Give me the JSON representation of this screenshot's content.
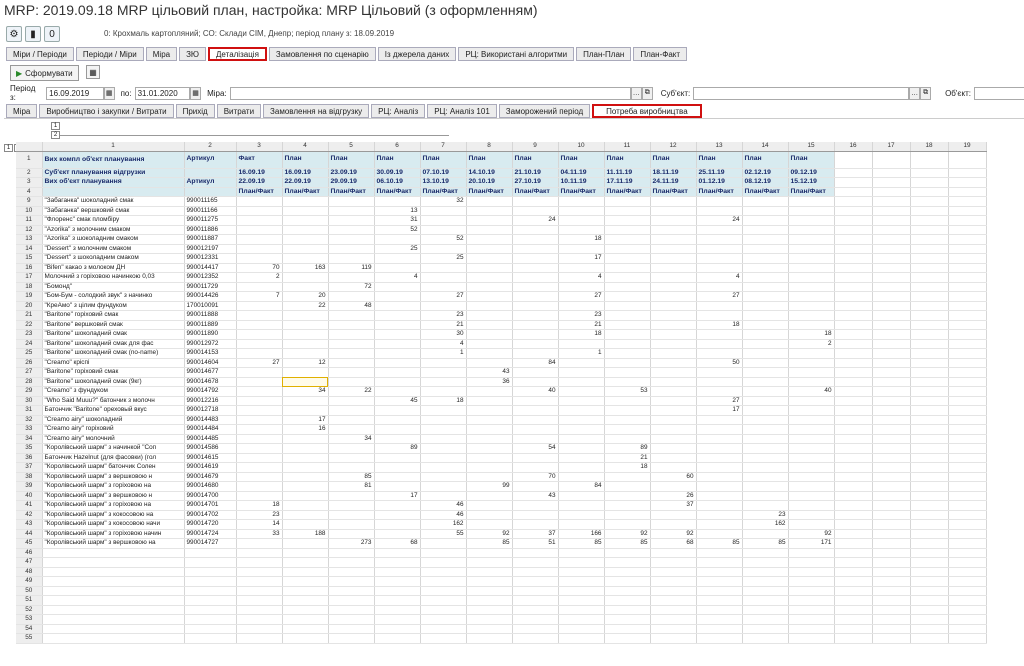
{
  "window": {
    "title": "MRP: 2019.09.18 MRP цільовий план, настройка: MRP Цільовий (з оформленням)"
  },
  "toolbar": {
    "counter": "0",
    "info": "0: Крохмаль картопляний; СО: Склади СІМ, Днепр; період плану з: 18.09.2019"
  },
  "tabs_top": [
    "Міри / Періоди",
    "Періоди / Міри",
    "Міра",
    "ЗЮ",
    "Деталізація",
    "Замовлення по сценарію",
    "Із джерела даних",
    "РЦ: Використані алгоритми",
    "План-План",
    "План-Факт"
  ],
  "buttons": {
    "generate": "Сформувати"
  },
  "filters": {
    "period_from_label": "Період з:",
    "period_from": "16.09.2019",
    "period_to_label": "по:",
    "period_to": "31.01.2020",
    "mira_label": "Міра:",
    "mira_value": "",
    "subject_label": "Суб'єкт:",
    "subject_value": "",
    "object_label": "Об'єкт:",
    "object_value": ""
  },
  "tabs_second": [
    "Міра",
    "Виробництво і закупки / Витрати",
    "Прихід",
    "Витрати",
    "Замовлення на відгрузку",
    "РЦ: Аналіз",
    "РЦ: Аналіз 101",
    "Заморожений період",
    "Потреба виробництва"
  ],
  "grid": {
    "outline_levels": [
      "1",
      "2",
      "3"
    ],
    "outline_markers": [
      "1",
      "2"
    ],
    "col_headers": [
      "1",
      "2",
      "3",
      "4",
      "5",
      "6",
      "7",
      "8",
      "9",
      "10",
      "11",
      "12",
      "13",
      "14",
      "15",
      "16",
      "17",
      "18",
      "19"
    ],
    "h1": {
      "a": "Вих компл об'єкт планування",
      "b": "Артикул",
      "vals": [
        "Факт",
        "План",
        "План",
        "План",
        "План",
        "План",
        "План",
        "План",
        "План",
        "План",
        "План",
        "План",
        "План"
      ]
    },
    "h2": {
      "a": "Суб'єкт планування відгрузки",
      "b": "",
      "vals": [
        "16.09.19",
        "16.09.19",
        "23.09.19",
        "30.09.19",
        "07.10.19",
        "14.10.19",
        "21.10.19",
        "04.11.19",
        "11.11.19",
        "18.11.19",
        "25.11.19",
        "02.12.19",
        "09.12.19"
      ]
    },
    "h3": {
      "a": "Вих об'єкт планування",
      "b": "Артикул",
      "vals": [
        "22.09.19",
        "22.09.19",
        "29.09.19",
        "06.10.19",
        "13.10.19",
        "20.10.19",
        "27.10.19",
        "10.11.19",
        "17.11.19",
        "24.11.19",
        "01.12.19",
        "08.12.19",
        "15.12.19"
      ]
    },
    "h4": {
      "a": "",
      "b": "",
      "vals": [
        "План/Факт",
        "План/Факт",
        "План/Факт",
        "План/Факт",
        "План/Факт",
        "План/Факт",
        "План/Факт",
        "План/Факт",
        "План/Факт",
        "План/Факт",
        "План/Факт",
        "План/Факт",
        "План/Факт"
      ]
    },
    "rows": [
      {
        "n": "9",
        "name": "\"Забаганка\" шоколадний смак",
        "art": "990011165",
        "v": [
          "",
          "",
          "",
          "",
          "32",
          "",
          "",
          "",
          "",
          "",
          "",
          "",
          ""
        ]
      },
      {
        "n": "10",
        "name": "\"Забаганка\" вершковий смак",
        "art": "990011166",
        "v": [
          "",
          "",
          "",
          "13",
          "",
          "",
          "",
          "",
          "",
          "",
          "",
          "",
          ""
        ]
      },
      {
        "n": "11",
        "name": "\"Флоренс\" смак пломбіру",
        "art": "990011275",
        "v": [
          "",
          "",
          "",
          "31",
          "",
          "",
          "24",
          "",
          "",
          "",
          "24",
          "",
          ""
        ]
      },
      {
        "n": "12",
        "name": "\"Azorika\" з молочним смаком",
        "art": "990011886",
        "v": [
          "",
          "",
          "",
          "52",
          "",
          "",
          "",
          "",
          "",
          "",
          "",
          "",
          ""
        ]
      },
      {
        "n": "13",
        "name": "\"Azorika\" з шоколадним смаком",
        "art": "990011887",
        "v": [
          "",
          "",
          "",
          "",
          "52",
          "",
          "",
          "18",
          "",
          "",
          "",
          "",
          ""
        ]
      },
      {
        "n": "14",
        "name": "\"Dessert\" з молочним смаком",
        "art": "990012197",
        "v": [
          "",
          "",
          "",
          "25",
          "",
          "",
          "",
          "",
          "",
          "",
          "",
          "",
          ""
        ]
      },
      {
        "n": "15",
        "name": "\"Dessert\" з шоколадним смаком",
        "art": "990012331",
        "v": [
          "",
          "",
          "",
          "",
          "25",
          "",
          "",
          "17",
          "",
          "",
          "",
          "",
          ""
        ]
      },
      {
        "n": "16",
        "name": "\"Bifen\" какао з молоком ДН",
        "art": "990014417",
        "v": [
          "70",
          "163",
          "119",
          "",
          "",
          "",
          "",
          "",
          "",
          "",
          "",
          "",
          ""
        ]
      },
      {
        "n": "17",
        "name": "Молочний з горіховою начинкою 0,03",
        "art": "990012352",
        "v": [
          "2",
          "",
          "",
          "4",
          "",
          "",
          "",
          "4",
          "",
          "",
          "4",
          "",
          ""
        ]
      },
      {
        "n": "18",
        "name": "\"Бомонд\"",
        "art": "990011729",
        "v": [
          "",
          "",
          "72",
          "",
          "",
          "",
          "",
          "",
          "",
          "",
          "",
          "",
          ""
        ]
      },
      {
        "n": "19",
        "name": "\"Бом-Бум - солодкий звук\" з начинко",
        "art": "990014426",
        "v": [
          "7",
          "20",
          "",
          "",
          "27",
          "",
          "",
          "27",
          "",
          "",
          "27",
          "",
          ""
        ]
      },
      {
        "n": "20",
        "name": "\"КреАмо\" з цілим фундуком",
        "art": "170010091",
        "v": [
          "",
          "22",
          "48",
          "",
          "",
          "",
          "",
          "",
          "",
          "",
          "",
          "",
          ""
        ]
      },
      {
        "n": "21",
        "name": "\"Baritone\" горіховий смак",
        "art": "990011888",
        "v": [
          "",
          "",
          "",
          "",
          "23",
          "",
          "",
          "23",
          "",
          "",
          "",
          "",
          ""
        ]
      },
      {
        "n": "22",
        "name": "\"Baritone\" вершковий смак",
        "art": "990011889",
        "v": [
          "",
          "",
          "",
          "",
          "21",
          "",
          "",
          "21",
          "",
          "",
          "18",
          "",
          ""
        ]
      },
      {
        "n": "23",
        "name": "\"Baritone\" шоколадний смак",
        "art": "990011890",
        "v": [
          "",
          "",
          "",
          "",
          "30",
          "",
          "",
          "18",
          "",
          "",
          "",
          "",
          "18"
        ]
      },
      {
        "n": "24",
        "name": "\"Baritone\" шоколадний смак для фас",
        "art": "990012972",
        "v": [
          "",
          "",
          "",
          "",
          "4",
          "",
          "",
          "",
          "",
          "",
          "",
          "",
          "2"
        ]
      },
      {
        "n": "25",
        "name": "\"Baritone\" шоколадний смак (no-name)",
        "art": "990014153",
        "v": [
          "",
          "",
          "",
          "",
          "1",
          "",
          "",
          "1",
          "",
          "",
          "",
          "",
          ""
        ]
      },
      {
        "n": "26",
        "name": "\"Creamo\" кріспі",
        "art": "990014604",
        "v": [
          "27",
          "12",
          "",
          "",
          "",
          "",
          "84",
          "",
          "",
          "",
          "50",
          "",
          ""
        ]
      },
      {
        "n": "27",
        "name": "\"Baritone\" горіховий смак",
        "art": "990014677",
        "v": [
          "",
          "",
          "",
          "",
          "",
          "43",
          "",
          "",
          "",
          "",
          "",
          "",
          ""
        ]
      },
      {
        "n": "28",
        "name": "\"Baritone\" шоколадний смак (9кг)",
        "art": "990014678",
        "v": [
          "",
          "",
          "",
          "",
          "",
          "36",
          "",
          "",
          "",
          "",
          "",
          "",
          ""
        ]
      },
      {
        "n": "29",
        "name": "\"Creamo\" з фундуком",
        "art": "990014792",
        "v": [
          "",
          "34",
          "22",
          "",
          "",
          "",
          "40",
          "",
          "53",
          "",
          "",
          "",
          "40"
        ]
      },
      {
        "n": "30",
        "name": "\"Who Said Muuu?\" батончик з молочн",
        "art": "990012216",
        "v": [
          "",
          "",
          "",
          "45",
          "18",
          "",
          "",
          "",
          "",
          "",
          "27",
          "",
          ""
        ]
      },
      {
        "n": "31",
        "name": "Батончик \"Baritone\" ореховый вкус",
        "art": "990012718",
        "v": [
          "",
          "",
          "",
          "",
          "",
          "",
          "",
          "",
          "",
          "",
          "17",
          "",
          ""
        ]
      },
      {
        "n": "32",
        "name": "\"Creamo airy\" шоколадний",
        "art": "990014483",
        "v": [
          "",
          "17",
          "",
          "",
          "",
          "",
          "",
          "",
          "",
          "",
          "",
          "",
          ""
        ]
      },
      {
        "n": "33",
        "name": "\"Creamo airy\" горіховий",
        "art": "990014484",
        "v": [
          "",
          "16",
          "",
          "",
          "",
          "",
          "",
          "",
          "",
          "",
          "",
          "",
          ""
        ]
      },
      {
        "n": "34",
        "name": "\"Creamo airy\" молочний",
        "art": "990014485",
        "v": [
          "",
          "",
          "34",
          "",
          "",
          "",
          "",
          "",
          "",
          "",
          "",
          "",
          ""
        ]
      },
      {
        "n": "35",
        "name": "\"Королівський шарм\" з начинкой \"Соп",
        "art": "990014586",
        "v": [
          "",
          "",
          "",
          "89",
          "",
          "",
          "54",
          "",
          "89",
          "",
          "",
          "",
          ""
        ]
      },
      {
        "n": "36",
        "name": "Батончик Hazelnut (для фасовки) (гол",
        "art": "990014615",
        "v": [
          "",
          "",
          "",
          "",
          "",
          "",
          "",
          "",
          "21",
          "",
          "",
          "",
          ""
        ]
      },
      {
        "n": "37",
        "name": "\"Королівський шарм\" батончик Солен",
        "art": "990014619",
        "v": [
          "",
          "",
          "",
          "",
          "",
          "",
          "",
          "",
          "18",
          "",
          "",
          "",
          ""
        ]
      },
      {
        "n": "38",
        "name": "\"Королівський шарм\" з вершковою н",
        "art": "990014679",
        "v": [
          "",
          "",
          "85",
          "",
          "",
          "",
          "70",
          "",
          "",
          "60",
          "",
          "",
          ""
        ]
      },
      {
        "n": "39",
        "name": "\"Королівський шарм\" з горіховою на",
        "art": "990014680",
        "v": [
          "",
          "",
          "81",
          "",
          "",
          "99",
          "",
          "84",
          "",
          "",
          "",
          "",
          ""
        ]
      },
      {
        "n": "40",
        "name": "\"Королівський шарм\" з вершковою н",
        "art": "990014700",
        "v": [
          "",
          "",
          "",
          "17",
          "",
          "",
          "43",
          "",
          "",
          "26",
          "",
          "",
          ""
        ]
      },
      {
        "n": "41",
        "name": "\"Королівський шарм\" з горіховою на",
        "art": "990014701",
        "v": [
          "18",
          "",
          "",
          "",
          "46",
          "",
          "",
          "",
          "",
          "37",
          "",
          "",
          ""
        ]
      },
      {
        "n": "42",
        "name": "\"Королівський шарм\" з кокосовою на",
        "art": "990014702",
        "v": [
          "23",
          "",
          "",
          "",
          "46",
          "",
          "",
          "",
          "",
          "",
          "",
          "23",
          ""
        ]
      },
      {
        "n": "43",
        "name": "\"Королівський шарм\" з кокосовою начи",
        "art": "990014720",
        "v": [
          "14",
          "",
          "",
          "",
          "162",
          "",
          "",
          "",
          "",
          "",
          "",
          "162",
          ""
        ]
      },
      {
        "n": "44",
        "name": "\"Королівський шарм\" з горіховою начин",
        "art": "990014724",
        "v": [
          "33",
          "188",
          "",
          "",
          "55",
          "92",
          "37",
          "166",
          "92",
          "92",
          "",
          "",
          "92"
        ]
      },
      {
        "n": "45",
        "name": "\"Королівський шарм\" з вершковою на",
        "art": "990014727",
        "v": [
          "",
          "",
          "273",
          "68",
          "",
          "85",
          "51",
          "85",
          "85",
          "68",
          "85",
          "85",
          "171"
        ]
      }
    ],
    "empty_rows": [
      "46",
      "47",
      "48",
      "49",
      "50",
      "51",
      "52",
      "53",
      "54",
      "55"
    ]
  },
  "colors": {
    "header_bg": "#d8ebf0",
    "header_text": "#1a2a6a",
    "highlight": "#d01010",
    "selection": "#e0b000"
  }
}
